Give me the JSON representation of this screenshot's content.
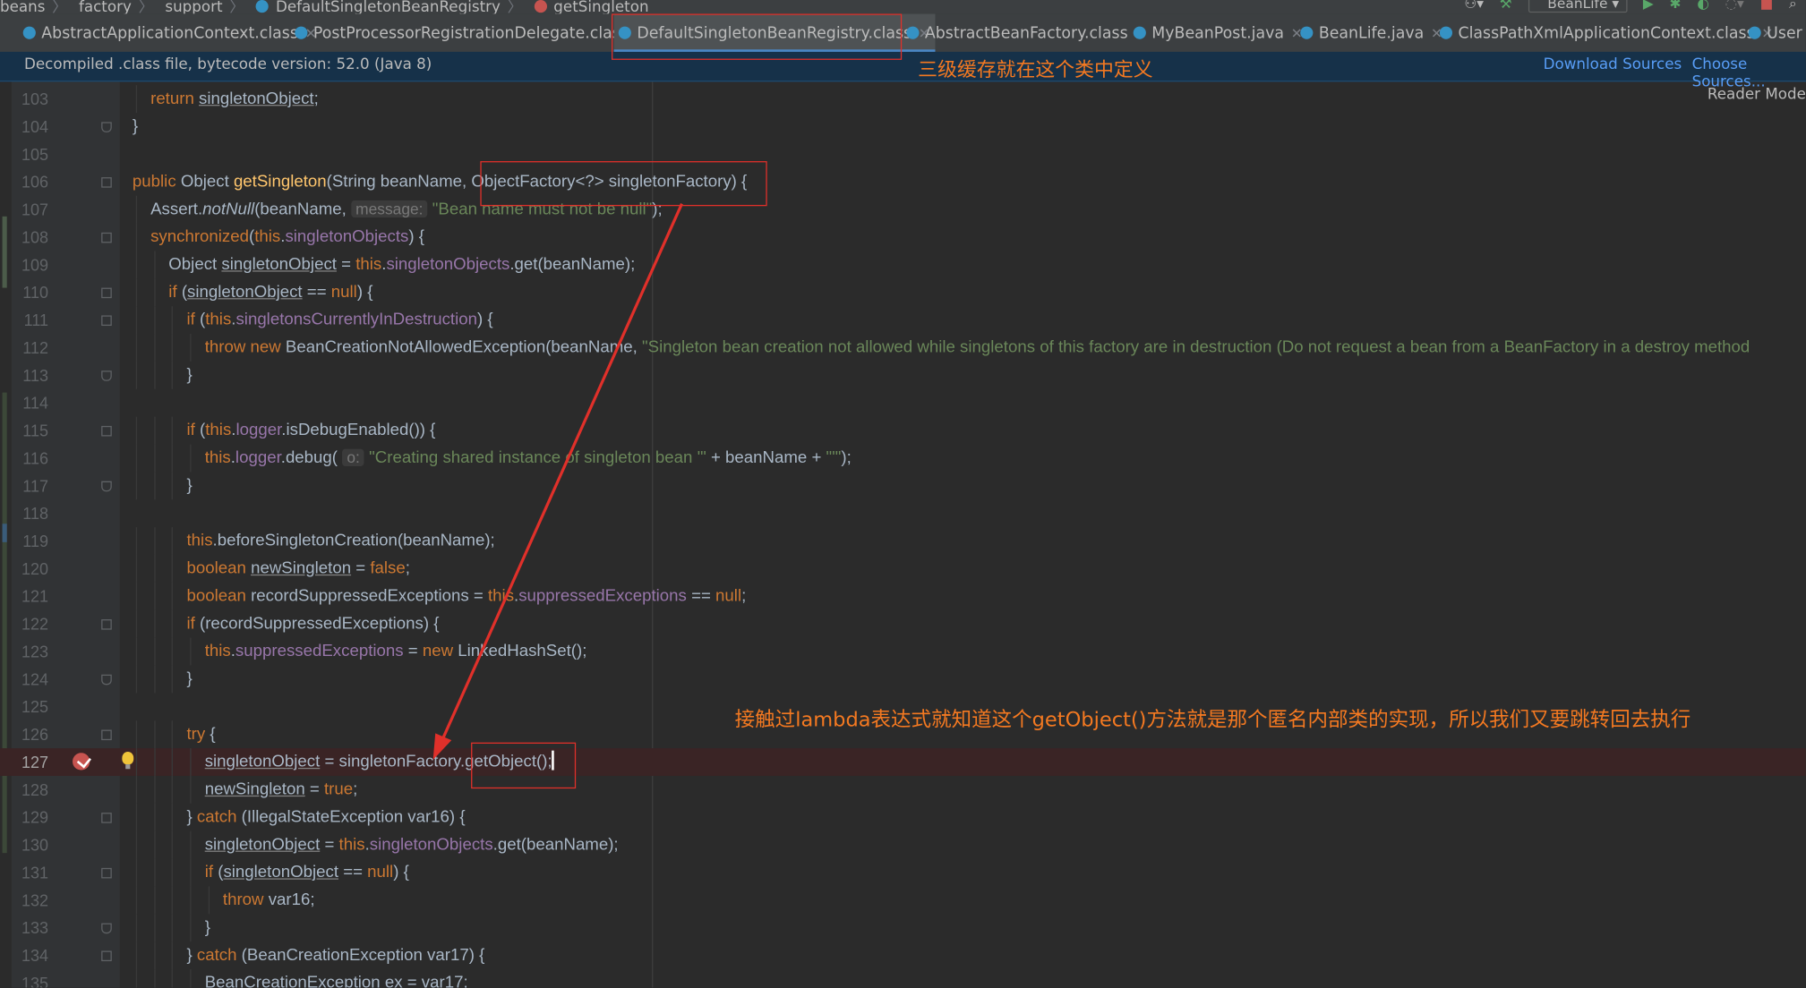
{
  "breadcrumb": [
    "beans",
    "factory",
    "support",
    "DefaultSingletonBeanRegistry",
    "getSingleton"
  ],
  "run_config": "BeanLife",
  "tabs": [
    {
      "label": "AbstractApplicationContext.class",
      "icon": "class-icon"
    },
    {
      "label": "PostProcessorRegistrationDelegate.class",
      "icon": "class-icon"
    },
    {
      "label": "DefaultSingletonBeanRegistry.class",
      "icon": "class-icon",
      "active": true
    },
    {
      "label": "AbstractBeanFactory.class",
      "icon": "class-icon"
    },
    {
      "label": "MyBeanPost.java",
      "icon": "java-class-icon"
    },
    {
      "label": "BeanLife.java",
      "icon": "java-class-icon"
    },
    {
      "label": "ClassPathXmlApplicationContext.class",
      "icon": "class-icon"
    },
    {
      "label": "User",
      "icon": "class-icon"
    }
  ],
  "banner": {
    "text": "Decompiled .class file, bytecode version: 52.0 (Java 8)",
    "download": "Download Sources",
    "choose": "Choose Sources..."
  },
  "reader_mode": "Reader Mode",
  "annotations": {
    "top_note": "三级缓存就在这个类中定义",
    "mid_note": "接触过lambda表达式就知道这个getObject()方法就是那个匿名内部类的实现，所以我们又要跳转回去执行"
  },
  "colors": {
    "keyword": "#cc7832",
    "field": "#9876aa",
    "method": "#ffc66d",
    "string": "#6a8759",
    "annotation": "#e0302a",
    "note": "#f47921"
  },
  "editor": {
    "current_line": 127,
    "breakpoint_line": 127,
    "lines": [
      {
        "n": "103",
        "indent": 1,
        "parts": [
          [
            "kw",
            "return "
          ],
          [
            "ul",
            "singletonObject"
          ],
          [
            "",
            "; "
          ]
        ]
      },
      {
        "n": "104",
        "indent": 0,
        "parts": [
          [
            "",
            "}"
          ]
        ]
      },
      {
        "n": "105",
        "indent": 0,
        "parts": []
      },
      {
        "n": "106",
        "indent": 0,
        "parts": [
          [
            "kw",
            "public "
          ],
          [
            "",
            "Object "
          ],
          [
            "fn",
            "getSingleton"
          ],
          [
            "",
            "(String beanName, ObjectFactory<?> singletonFactory) {"
          ]
        ]
      },
      {
        "n": "107",
        "indent": 1,
        "parts": [
          [
            "",
            "Assert."
          ],
          [
            "it",
            "notNull"
          ],
          [
            "",
            "(beanName, "
          ],
          [
            "hint",
            "message:"
          ],
          [
            "",
            " "
          ],
          [
            "st",
            "\"Bean name must not be null\""
          ],
          [
            "",
            ");"
          ]
        ]
      },
      {
        "n": "108",
        "indent": 1,
        "parts": [
          [
            "kw",
            "synchronized"
          ],
          [
            "",
            "("
          ],
          [
            "kw",
            "this"
          ],
          [
            "",
            "."
          ],
          [
            "fd",
            "singletonObjects"
          ],
          [
            "",
            ") {"
          ]
        ]
      },
      {
        "n": "109",
        "indent": 2,
        "parts": [
          [
            "",
            "Object "
          ],
          [
            "ul",
            "singletonObject"
          ],
          [
            "",
            " = "
          ],
          [
            "kw",
            "this"
          ],
          [
            "",
            "."
          ],
          [
            "fd",
            "singletonObjects"
          ],
          [
            "",
            ".get(beanName);"
          ]
        ]
      },
      {
        "n": "110",
        "indent": 2,
        "parts": [
          [
            "kw",
            "if "
          ],
          [
            "",
            "("
          ],
          [
            "ul",
            "singletonObject"
          ],
          [
            "",
            " == "
          ],
          [
            "kw",
            "null"
          ],
          [
            "",
            ") {"
          ]
        ]
      },
      {
        "n": "111",
        "indent": 3,
        "parts": [
          [
            "kw",
            "if "
          ],
          [
            "",
            "("
          ],
          [
            "kw",
            "this"
          ],
          [
            "",
            "."
          ],
          [
            "fd",
            "singletonsCurrentlyInDestruction"
          ],
          [
            "",
            ") {"
          ]
        ]
      },
      {
        "n": "112",
        "indent": 4,
        "parts": [
          [
            "kw",
            "throw new "
          ],
          [
            "",
            "BeanCreationNotAllowedException(beanName, "
          ],
          [
            "st",
            "\"Singleton bean creation not allowed while singletons of this factory are in destruction (Do not request a bean from a BeanFactory in a destroy method"
          ]
        ]
      },
      {
        "n": "113",
        "indent": 3,
        "parts": [
          [
            "",
            "}"
          ]
        ]
      },
      {
        "n": "114",
        "indent": 0,
        "parts": []
      },
      {
        "n": "115",
        "indent": 3,
        "parts": [
          [
            "kw",
            "if "
          ],
          [
            "",
            "("
          ],
          [
            "kw",
            "this"
          ],
          [
            "",
            "."
          ],
          [
            "fd",
            "logger"
          ],
          [
            "",
            ".isDebugEnabled()) {"
          ]
        ]
      },
      {
        "n": "116",
        "indent": 4,
        "parts": [
          [
            "kw",
            "this"
          ],
          [
            "",
            "."
          ],
          [
            "fd",
            "logger"
          ],
          [
            "",
            ".debug( "
          ],
          [
            "hint",
            "o:"
          ],
          [
            "",
            " "
          ],
          [
            "st",
            "\"Creating shared instance of singleton bean '\""
          ],
          [
            "",
            " + beanName + "
          ],
          [
            "st",
            "\"'\""
          ],
          [
            "",
            ");"
          ]
        ]
      },
      {
        "n": "117",
        "indent": 3,
        "parts": [
          [
            "",
            "}"
          ]
        ]
      },
      {
        "n": "118",
        "indent": 0,
        "parts": []
      },
      {
        "n": "119",
        "indent": 3,
        "parts": [
          [
            "kw",
            "this"
          ],
          [
            "",
            ".beforeSingletonCreation(beanName);"
          ]
        ]
      },
      {
        "n": "120",
        "indent": 3,
        "parts": [
          [
            "kw",
            "boolean "
          ],
          [
            "ul",
            "newSingleton"
          ],
          [
            "",
            " = "
          ],
          [
            "kw",
            "false"
          ],
          [
            "",
            ";"
          ]
        ]
      },
      {
        "n": "121",
        "indent": 3,
        "parts": [
          [
            "kw",
            "boolean "
          ],
          [
            "",
            "recordSuppressedExceptions = "
          ],
          [
            "kw",
            "this"
          ],
          [
            "",
            "."
          ],
          [
            "fd",
            "suppressedExceptions"
          ],
          [
            "",
            " == "
          ],
          [
            "kw",
            "null"
          ],
          [
            "",
            ";"
          ]
        ]
      },
      {
        "n": "122",
        "indent": 3,
        "parts": [
          [
            "kw",
            "if "
          ],
          [
            "",
            "(recordSuppressedExceptions) {"
          ]
        ]
      },
      {
        "n": "123",
        "indent": 4,
        "parts": [
          [
            "kw",
            "this"
          ],
          [
            "",
            "."
          ],
          [
            "fd",
            "suppressedExceptions"
          ],
          [
            "",
            " = "
          ],
          [
            "kw",
            "new "
          ],
          [
            "",
            "LinkedHashSet();"
          ]
        ]
      },
      {
        "n": "124",
        "indent": 3,
        "parts": [
          [
            "",
            "}"
          ]
        ]
      },
      {
        "n": "125",
        "indent": 0,
        "parts": []
      },
      {
        "n": "126",
        "indent": 3,
        "parts": [
          [
            "kw",
            "try "
          ],
          [
            "",
            "{"
          ]
        ]
      },
      {
        "n": "127",
        "indent": 4,
        "parts": [
          [
            "ul",
            "singletonObject"
          ],
          [
            "",
            " = singletonFactory.getObject();"
          ]
        ]
      },
      {
        "n": "128",
        "indent": 4,
        "parts": [
          [
            "ul",
            "newSingleton"
          ],
          [
            "",
            " = "
          ],
          [
            "kw",
            "true"
          ],
          [
            "",
            ";"
          ]
        ]
      },
      {
        "n": "129",
        "indent": 3,
        "parts": [
          [
            "",
            "} "
          ],
          [
            "kw",
            "catch "
          ],
          [
            "",
            "(IllegalStateException var16) {"
          ]
        ]
      },
      {
        "n": "130",
        "indent": 4,
        "parts": [
          [
            "ul",
            "singletonObject"
          ],
          [
            "",
            " = "
          ],
          [
            "kw",
            "this"
          ],
          [
            "",
            "."
          ],
          [
            "fd",
            "singletonObjects"
          ],
          [
            "",
            ".get(beanName);"
          ]
        ]
      },
      {
        "n": "131",
        "indent": 4,
        "parts": [
          [
            "kw",
            "if "
          ],
          [
            "",
            "("
          ],
          [
            "ul",
            "singletonObject"
          ],
          [
            "",
            " == "
          ],
          [
            "kw",
            "null"
          ],
          [
            "",
            ") {"
          ]
        ]
      },
      {
        "n": "132",
        "indent": 5,
        "parts": [
          [
            "kw",
            "throw "
          ],
          [
            "",
            "var16;"
          ]
        ]
      },
      {
        "n": "133",
        "indent": 4,
        "parts": [
          [
            "",
            "}"
          ]
        ]
      },
      {
        "n": "134",
        "indent": 3,
        "parts": [
          [
            "",
            "} "
          ],
          [
            "kw",
            "catch "
          ],
          [
            "",
            "(BeanCreationException var17) {"
          ]
        ]
      },
      {
        "n": "135",
        "indent": 4,
        "parts": [
          [
            "",
            "BeanCreationException ex = var17;"
          ]
        ]
      }
    ]
  }
}
